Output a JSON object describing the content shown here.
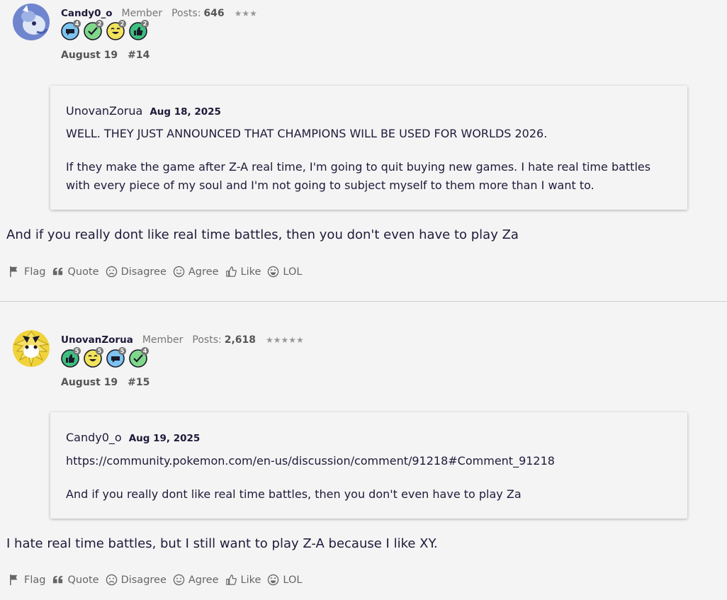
{
  "posts": [
    {
      "author": "Candy0_o",
      "role": "Member",
      "posts_label": "Posts:",
      "posts_count": "646",
      "stars": "★★★",
      "badges": [
        {
          "icon": "comment-icon",
          "count": "4"
        },
        {
          "icon": "check-icon",
          "count": "2"
        },
        {
          "icon": "laugh-icon",
          "count": "2"
        },
        {
          "icon": "thumbs-up-icon",
          "count": "2"
        }
      ],
      "date": "August 19",
      "number": "#14",
      "quote": {
        "author": "UnovanZorua",
        "date": "Aug 18, 2025",
        "para1": "WELL. THEY JUST ANNOUNCED THAT CHAMPIONS WILL BE USED FOR WORLDS 2026.",
        "para2": "If they make the game after Z-A real time, I'm going to quit buying new games. I hate real time battles with every piece of my soul and I'm not going to subject myself to them more than I want to."
      },
      "text": "And if you really dont like real time battles, then you don't even have to play Za"
    },
    {
      "author": "UnovanZorua",
      "role": "Member",
      "posts_label": "Posts:",
      "posts_count": "2,618",
      "stars": "★★★★★",
      "badges": [
        {
          "icon": "thumbs-up-icon",
          "count": "5"
        },
        {
          "icon": "laugh-icon",
          "count": "5"
        },
        {
          "icon": "comment-icon",
          "count": "5"
        },
        {
          "icon": "check-icon",
          "count": "4"
        }
      ],
      "date": "August 19",
      "number": "#15",
      "quote": {
        "author": "Candy0_o",
        "date": "Aug 19, 2025",
        "para1": "https://community.pokemon.com/en-us/discussion/comment/91218#Comment_91218",
        "para2": "And if you really dont like real time battles, then you don't even have to play Za"
      },
      "text": "I hate real time battles, but I still want to play Z-A because I like XY."
    }
  ],
  "actions": {
    "flag": "Flag",
    "quote": "Quote",
    "disagree": "Disagree",
    "agree": "Agree",
    "like": "Like",
    "lol": "LOL"
  },
  "colors": {
    "background": "#f4f4f4",
    "text": "#1f1a3a",
    "badge_blue": "#7cc3f0",
    "badge_green": "#7fd88a",
    "badge_yellow": "#f2e35b",
    "badge_teal": "#3fbf7f"
  }
}
